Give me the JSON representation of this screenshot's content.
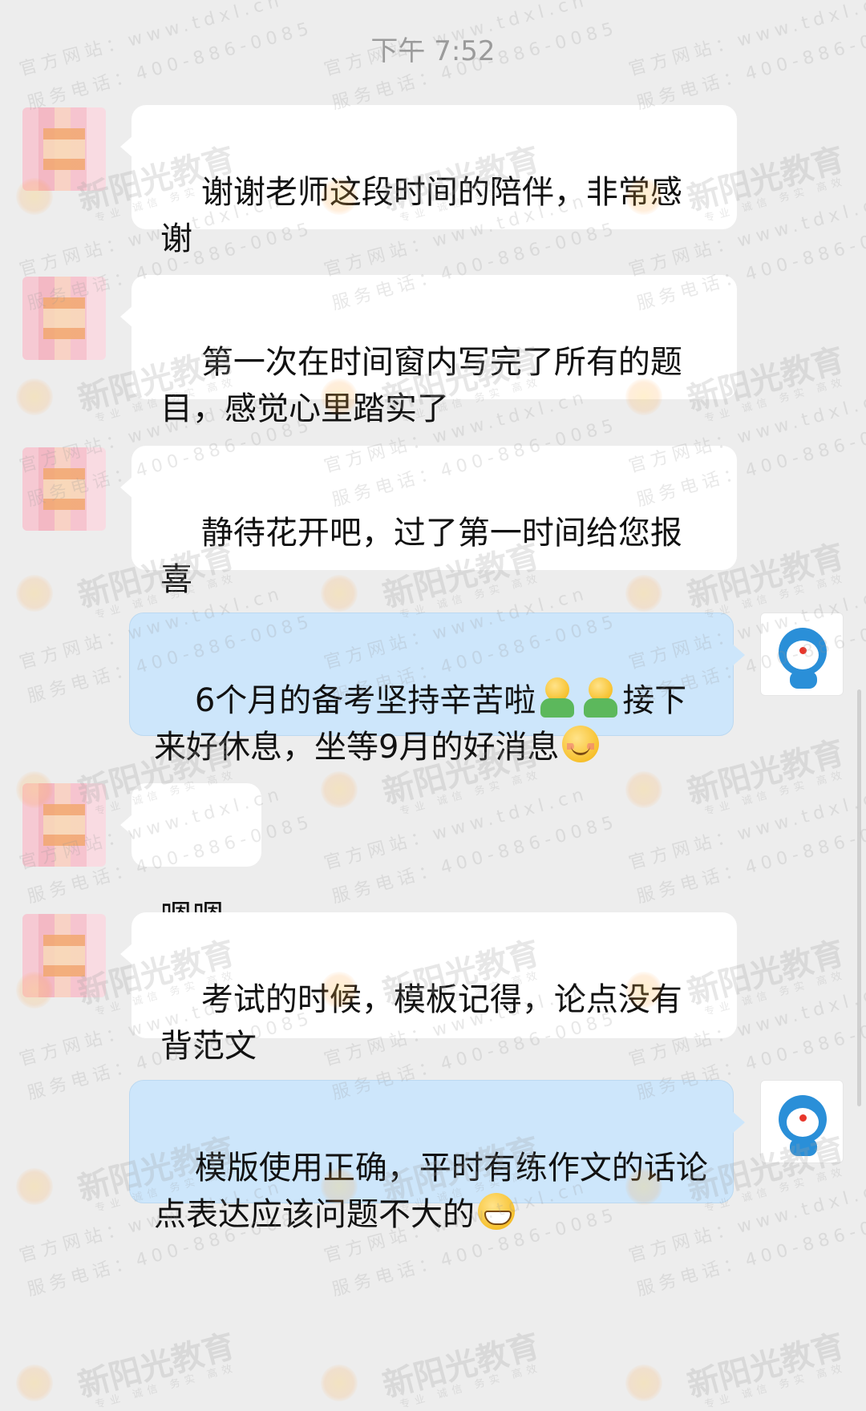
{
  "chat": {
    "timestamp": "下午 7:52",
    "messages": [
      {
        "side": "left",
        "text": "谢谢老师这段时间的陪伴，非常感谢"
      },
      {
        "side": "left",
        "text": "第一次在时间窗内写完了所有的题目，感觉心里踏实了"
      },
      {
        "side": "left",
        "text": "静待花开吧，过了第一时间给您报喜"
      },
      {
        "side": "right",
        "parts": [
          "6个月的备考坚持辛苦啦",
          "接下来好休息，坐等9月的好消息"
        ],
        "emojis": [
          "hug-emoji",
          "hug-emoji",
          "smile-emoji"
        ]
      },
      {
        "side": "left",
        "text": "嗯嗯"
      },
      {
        "side": "left",
        "text": "考试的时候，模板记得，论点没有背范文"
      },
      {
        "side": "right",
        "text": "模版使用正确，平时有练作文的话论点表达应该问题不大的",
        "emojis": [
          "grin-emoji"
        ]
      }
    ]
  },
  "watermark": {
    "brand": "新阳光教育",
    "site_line": "官方网站：www.tdxl.cn",
    "phone_line": "服务电话：400-886-0085",
    "tags": "专业  诚信  务实  高效"
  },
  "colors": {
    "background": "#ededed",
    "bubble_left": "#ffffff",
    "bubble_right": "#cde6fb",
    "timestamp": "#9b9b9b"
  }
}
